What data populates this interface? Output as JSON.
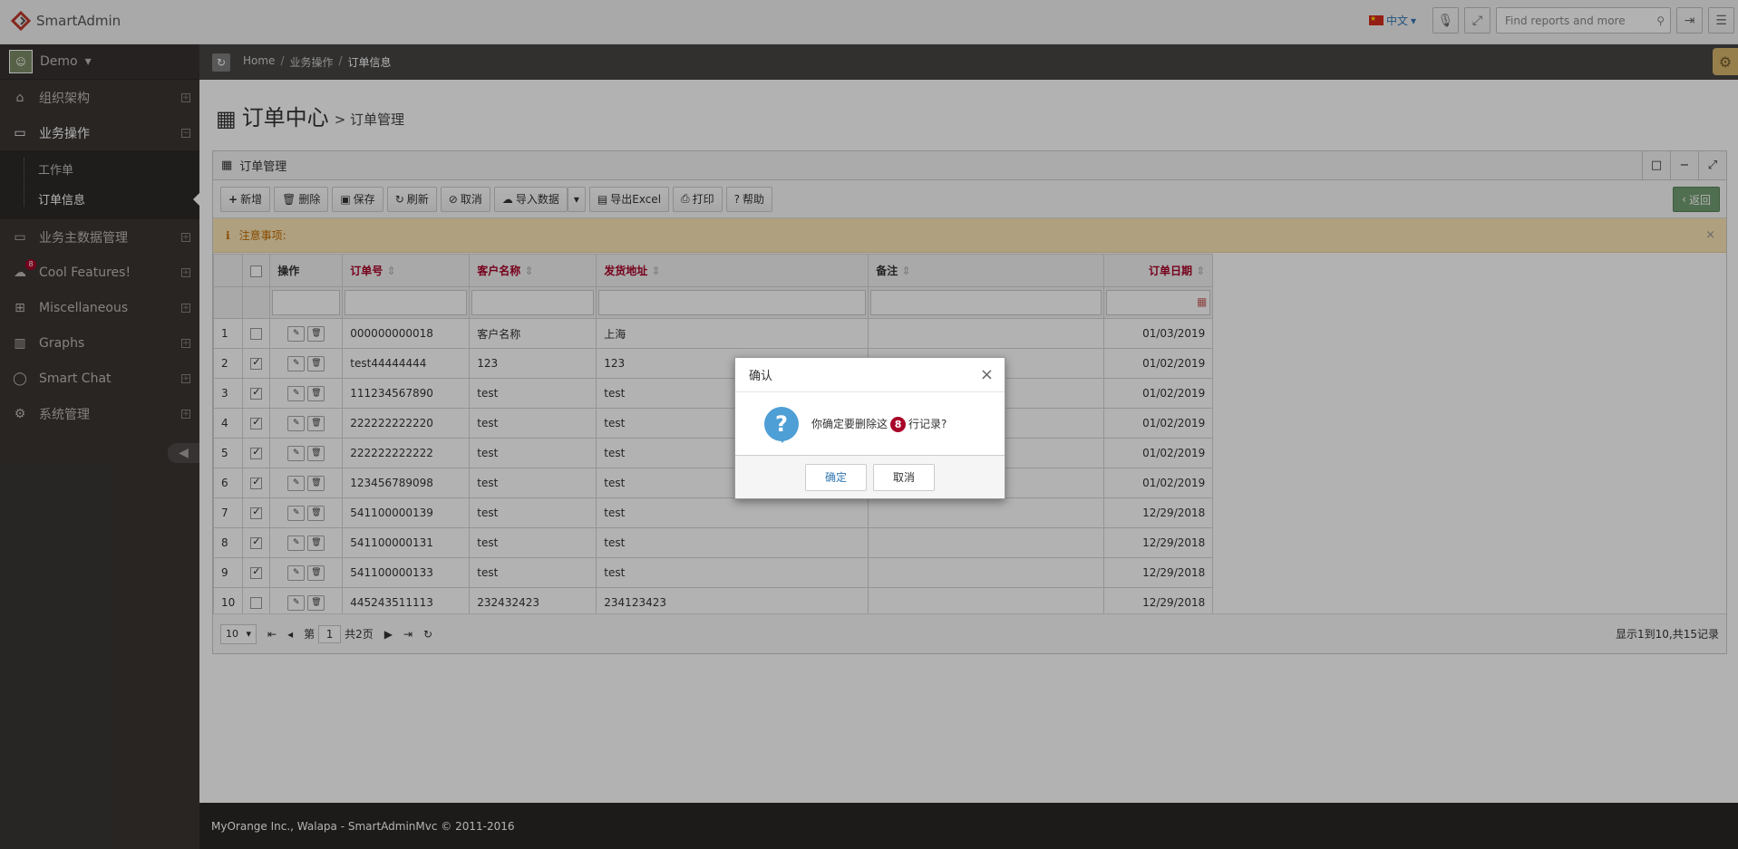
{
  "app": {
    "name": "SmartAdmin"
  },
  "header": {
    "language": "中文",
    "search_placeholder": "Find reports and more"
  },
  "user": {
    "name": "Demo"
  },
  "sidebar": {
    "items": [
      {
        "label": "组织架构",
        "icon": "home-icon"
      },
      {
        "label": "业务操作",
        "icon": "folder-icon"
      },
      {
        "label": "业务主数据管理",
        "icon": "folder-icon"
      },
      {
        "label": "Cool Features!",
        "icon": "cloud-icon",
        "badge": "8"
      },
      {
        "label": "Miscellaneous",
        "icon": "windows-icon"
      },
      {
        "label": "Graphs",
        "icon": "bar-chart-icon"
      },
      {
        "label": "Smart Chat",
        "icon": "comment-icon"
      },
      {
        "label": "系统管理",
        "icon": "gears-icon"
      }
    ],
    "subitems": [
      {
        "label": "工作单"
      },
      {
        "label": "订单信息"
      }
    ]
  },
  "breadcrumb": {
    "items": [
      "Home",
      "业务操作",
      "订单信息"
    ]
  },
  "page": {
    "title": "订单中心",
    "subtitle": "> 订单管理"
  },
  "widget": {
    "title": "订单管理"
  },
  "toolbar": {
    "add": "新增",
    "delete": "删除",
    "save": "保存",
    "refresh": "刷新",
    "cancel": "取消",
    "import": "导入数据",
    "export": "导出Excel",
    "print": "打印",
    "help": "帮助",
    "back": "返回"
  },
  "alert": {
    "text": "注意事项:"
  },
  "table": {
    "columns": [
      "操作",
      "订单号",
      "客户名称",
      "发货地址",
      "备注",
      "订单日期"
    ],
    "rows": [
      {
        "no": "1",
        "checked": false,
        "order": "000000000018",
        "customer": "客户名称",
        "address": "上海",
        "note": "",
        "date": "01/03/2019"
      },
      {
        "no": "2",
        "checked": true,
        "order": "test44444444",
        "customer": "123",
        "address": "123",
        "note": "",
        "date": "01/02/2019"
      },
      {
        "no": "3",
        "checked": true,
        "order": "111234567890",
        "customer": "test",
        "address": "test",
        "note": "",
        "date": "01/02/2019"
      },
      {
        "no": "4",
        "checked": true,
        "order": "222222222220",
        "customer": "test",
        "address": "test",
        "note": "",
        "date": "01/02/2019"
      },
      {
        "no": "5",
        "checked": true,
        "order": "222222222222",
        "customer": "test",
        "address": "test",
        "note": "",
        "date": "01/02/2019"
      },
      {
        "no": "6",
        "checked": true,
        "order": "123456789098",
        "customer": "test",
        "address": "test",
        "note": "",
        "date": "01/02/2019"
      },
      {
        "no": "7",
        "checked": true,
        "order": "541100000139",
        "customer": "test",
        "address": "test",
        "note": "",
        "date": "12/29/2018"
      },
      {
        "no": "8",
        "checked": true,
        "order": "541100000131",
        "customer": "test",
        "address": "test",
        "note": "",
        "date": "12/29/2018"
      },
      {
        "no": "9",
        "checked": true,
        "order": "541100000133",
        "customer": "test",
        "address": "test",
        "note": "",
        "date": "12/29/2018"
      },
      {
        "no": "10",
        "checked": false,
        "order": "445243511113",
        "customer": "232432423",
        "address": "234123423",
        "note": "",
        "date": "12/29/2018"
      }
    ]
  },
  "pager": {
    "page_size": "10",
    "page_prefix": "第",
    "page_value": "1",
    "page_total": "共2页",
    "info": "显示1到10,共15记录"
  },
  "footer": {
    "text": "MyOrange Inc., Walapa - SmartAdminMvc © 2011-2016"
  },
  "dialog": {
    "title": "确认",
    "msg_before": "你确定要删除这",
    "count": "8",
    "msg_after": "行记录?",
    "ok": "确定",
    "cancel": "取消"
  },
  "colors": {
    "accent": "#a90329",
    "sidebar": "#3a3633",
    "alert": "#fbe6b6",
    "back_button": "#739e73"
  }
}
